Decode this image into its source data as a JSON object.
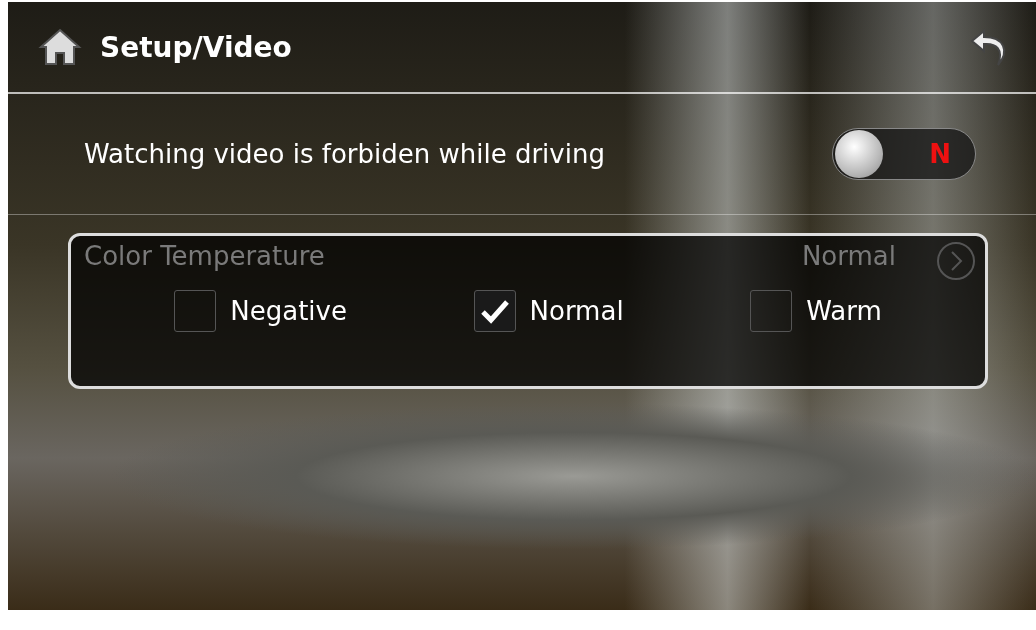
{
  "header": {
    "title": "Setup/Video"
  },
  "rows": [
    {
      "kind": "toggle",
      "label": "Watching video is forbiden while driving",
      "on": false,
      "toggle_text": "N"
    },
    {
      "kind": "value",
      "label": "Color Temperature",
      "value": "Normal"
    }
  ],
  "popup": {
    "options": [
      {
        "label": "Negative",
        "selected": false
      },
      {
        "label": "Normal",
        "selected": true
      },
      {
        "label": "Warm",
        "selected": false
      }
    ]
  }
}
